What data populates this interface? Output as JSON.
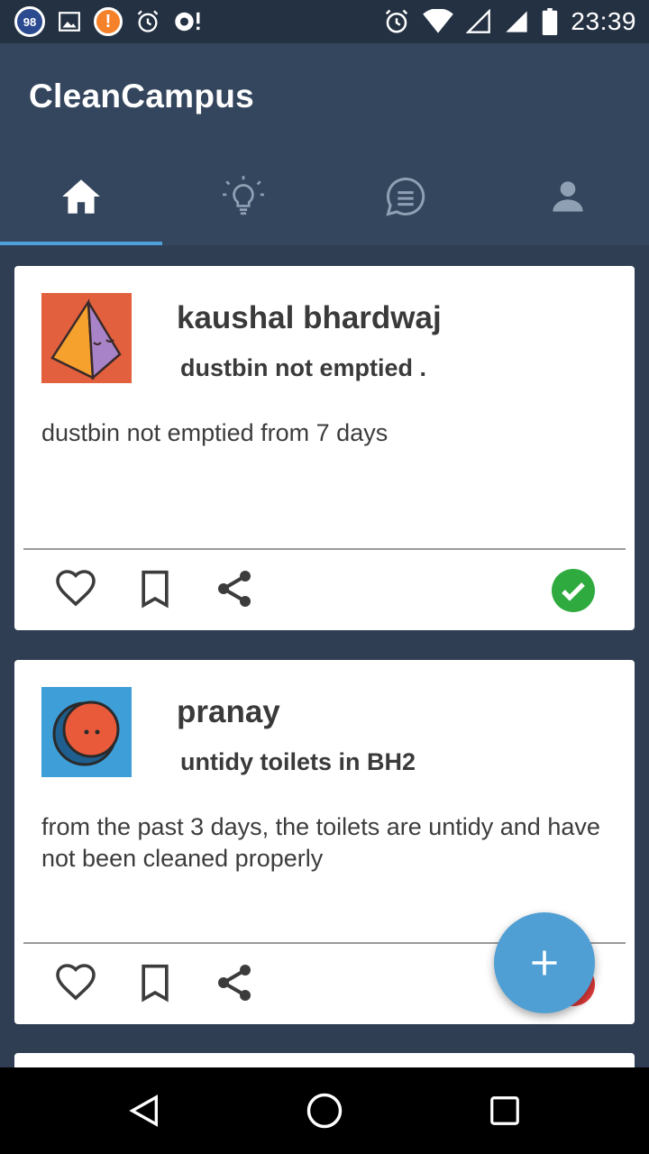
{
  "status_bar": {
    "notification_count": "98",
    "time": "23:39",
    "icons": [
      "badge-98-icon",
      "image-icon",
      "alert-icon",
      "alarm-icon",
      "sync-icon",
      "alarm-icon",
      "wifi-icon",
      "signal-empty-icon",
      "signal-icon",
      "battery-icon"
    ]
  },
  "app": {
    "title": "CleanCampus",
    "tabs": [
      {
        "icon": "home-icon",
        "active": true
      },
      {
        "icon": "lightbulb-icon",
        "active": false
      },
      {
        "icon": "chat-icon",
        "active": false
      },
      {
        "icon": "person-icon",
        "active": false
      }
    ],
    "accent": "#4fa0d8"
  },
  "posts": [
    {
      "author": "kaushal bhardwaj",
      "title": "dustbin not emptied .",
      "body": "dustbin not emptied from 7 days",
      "avatar": "pyramid-avatar",
      "status": "resolved",
      "status_color": "#2eaa3e"
    },
    {
      "author": "pranay",
      "title": "untidy toilets in BH2",
      "body": "from the past 3 days, the toilets are untidy and have not been cleaned properly",
      "avatar": "moon-avatar",
      "status": "unresolved",
      "status_color": "#e03a3a"
    }
  ],
  "fab": {
    "icon": "plus-icon",
    "color": "#4f9fd4"
  },
  "nav": [
    "back-icon",
    "home-circle-icon",
    "recents-icon"
  ]
}
